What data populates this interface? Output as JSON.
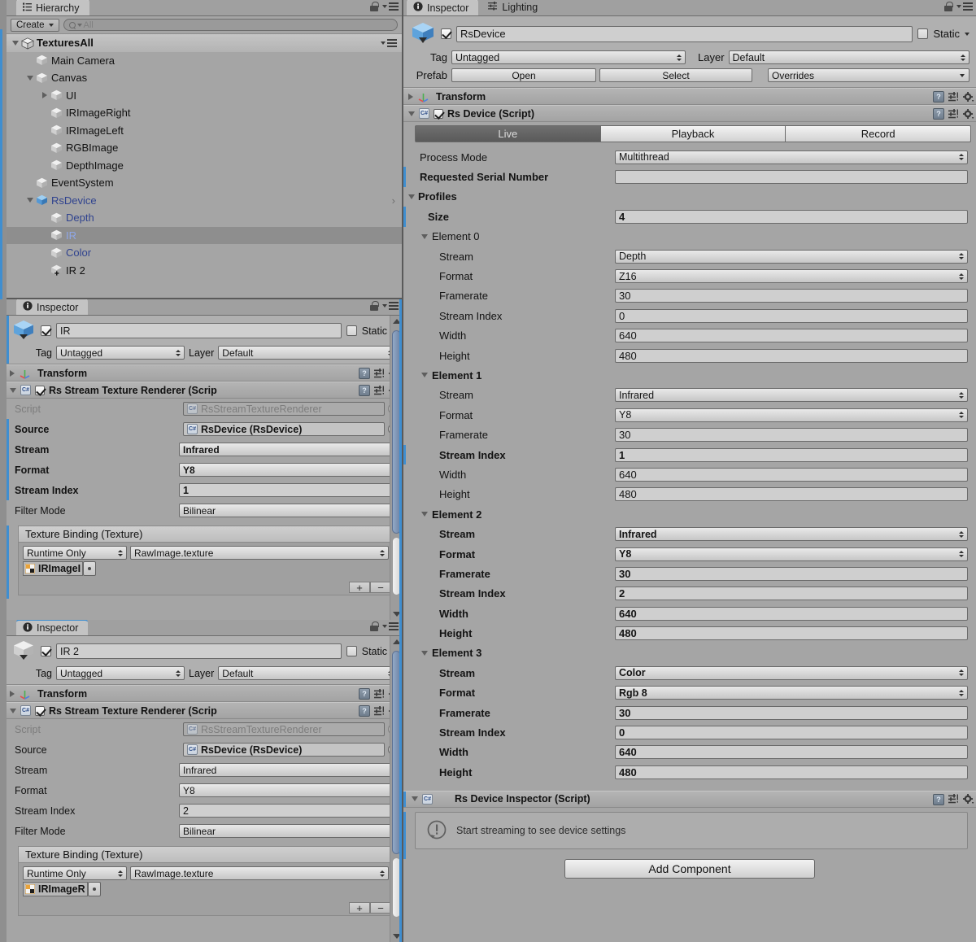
{
  "hierarchy": {
    "tab_label": "Hierarchy",
    "tab_icon": "hierarchy-icon",
    "create_label": "Create",
    "search_placeholder": "All",
    "search_value": "",
    "items": [
      {
        "label": "TexturesAll",
        "depth": 0,
        "fold": "down",
        "icon": "unity-scene-icon",
        "style": "scene"
      },
      {
        "label": "Main Camera",
        "depth": 1,
        "fold": "none",
        "icon": "gameobject-cube-icon",
        "style": "normal"
      },
      {
        "label": "Canvas",
        "depth": 1,
        "fold": "down",
        "icon": "gameobject-cube-icon",
        "style": "normal"
      },
      {
        "label": "UI",
        "depth": 2,
        "fold": "right",
        "icon": "gameobject-cube-icon",
        "style": "normal"
      },
      {
        "label": "IRImageRight",
        "depth": 2,
        "fold": "none",
        "icon": "gameobject-cube-icon",
        "style": "normal"
      },
      {
        "label": "IRImageLeft",
        "depth": 2,
        "fold": "none",
        "icon": "gameobject-cube-icon",
        "style": "normal"
      },
      {
        "label": "RGBImage",
        "depth": 2,
        "fold": "none",
        "icon": "gameobject-cube-icon",
        "style": "normal"
      },
      {
        "label": "DepthImage",
        "depth": 2,
        "fold": "none",
        "icon": "gameobject-cube-icon",
        "style": "normal"
      },
      {
        "label": "EventSystem",
        "depth": 1,
        "fold": "none",
        "icon": "gameobject-cube-icon",
        "style": "normal"
      },
      {
        "label": "RsDevice",
        "depth": 1,
        "fold": "down",
        "icon": "prefab-cube-icon",
        "style": "prefab",
        "chevron": true
      },
      {
        "label": "Depth",
        "depth": 2,
        "fold": "none",
        "icon": "gameobject-cube-icon",
        "style": "prefab"
      },
      {
        "label": "IR",
        "depth": 2,
        "fold": "none",
        "icon": "gameobject-cube-icon",
        "style": "selected"
      },
      {
        "label": "Color",
        "depth": 2,
        "fold": "none",
        "icon": "gameobject-cube-icon",
        "style": "prefab"
      },
      {
        "label": "IR 2",
        "depth": 2,
        "fold": "none",
        "icon": "gameobject-added-cube-icon",
        "style": "normal"
      }
    ]
  },
  "inspector_ir": {
    "tab_label": "Inspector",
    "name": "IR",
    "enabled": true,
    "static_label": "Static",
    "static_checked": false,
    "tag_label": "Tag",
    "tag_value": "Untagged",
    "layer_label": "Layer",
    "layer_value": "Default",
    "transform_label": "Transform",
    "component_label": "Rs Stream Texture Renderer (Scrip",
    "component_enabled": true,
    "fields": [
      {
        "label": "Script",
        "value": "RsStreamTextureRenderer",
        "type": "objectfield-readonly",
        "bold": false,
        "override": false
      },
      {
        "label": "Source",
        "value": "RsDevice (RsDevice)",
        "type": "objectfield",
        "bold": true,
        "override": true
      },
      {
        "label": "Stream",
        "value": "Infrared",
        "type": "dropdown",
        "bold": true,
        "override": true
      },
      {
        "label": "Format",
        "value": "Y8",
        "type": "dropdown",
        "bold": true,
        "override": true
      },
      {
        "label": "Stream Index",
        "value": "1",
        "type": "number",
        "bold": true,
        "override": true
      },
      {
        "label": "Filter Mode",
        "value": "Bilinear",
        "type": "dropdown",
        "bold": false,
        "override": false
      }
    ],
    "event_title": "Texture Binding (Texture)",
    "event_mode": "Runtime Only",
    "event_func": "RawImage.texture",
    "event_target": "IRImageI",
    "plus_label": "+",
    "minus_label": "−"
  },
  "inspector_ir2": {
    "tab_label": "Inspector",
    "name": "IR 2",
    "enabled": true,
    "static_label": "Static",
    "static_checked": false,
    "tag_label": "Tag",
    "tag_value": "Untagged",
    "layer_label": "Layer",
    "layer_value": "Default",
    "transform_label": "Transform",
    "component_label": "Rs Stream Texture Renderer (Scrip",
    "component_enabled": true,
    "fields": [
      {
        "label": "Script",
        "value": "RsStreamTextureRenderer",
        "type": "objectfield-readonly",
        "bold": false,
        "override": false
      },
      {
        "label": "Source",
        "value": "RsDevice (RsDevice)",
        "type": "objectfield",
        "bold": false,
        "override": false
      },
      {
        "label": "Stream",
        "value": "Infrared",
        "type": "dropdown",
        "bold": false,
        "override": false
      },
      {
        "label": "Format",
        "value": "Y8",
        "type": "dropdown",
        "bold": false,
        "override": false
      },
      {
        "label": "Stream Index",
        "value": "2",
        "type": "number",
        "bold": false,
        "override": false
      },
      {
        "label": "Filter Mode",
        "value": "Bilinear",
        "type": "dropdown",
        "bold": false,
        "override": false
      }
    ],
    "event_title": "Texture Binding (Texture)",
    "event_mode": "Runtime Only",
    "event_func": "RawImage.texture",
    "event_target": "IRImageR",
    "plus_label": "+",
    "minus_label": "−"
  },
  "inspector_device": {
    "tabs": [
      {
        "label": "Inspector",
        "icon": "info-icon",
        "active": true
      },
      {
        "label": "Lighting",
        "icon": "lighting-icon",
        "active": false
      }
    ],
    "name": "RsDevice",
    "enabled": true,
    "static_label": "Static",
    "static_checked": false,
    "tag_label": "Tag",
    "tag_value": "Untagged",
    "layer_label": "Layer",
    "layer_value": "Default",
    "prefab_label": "Prefab",
    "prefab_open": "Open",
    "prefab_select": "Select",
    "prefab_overrides": "Overrides",
    "transform_label": "Transform",
    "component_label": "Rs Device (Script)",
    "component_enabled": true,
    "mode_tabs": [
      {
        "label": "Live",
        "selected": true
      },
      {
        "label": "Playback",
        "selected": false
      },
      {
        "label": "Record",
        "selected": false
      }
    ],
    "process_mode_label": "Process Mode",
    "process_mode_value": "Multithread",
    "serial_label": "Requested Serial Number",
    "serial_value": "",
    "profiles_label": "Profiles",
    "size_label": "Size",
    "size_value": "4",
    "elements": [
      {
        "title": "Element 0",
        "title_bold": false,
        "override": false,
        "rows": [
          {
            "label": "Stream",
            "value": "Depth",
            "type": "dropdown",
            "bold": false,
            "override": false
          },
          {
            "label": "Format",
            "value": "Z16",
            "type": "dropdown",
            "bold": false,
            "override": false
          },
          {
            "label": "Framerate",
            "value": "30",
            "type": "number",
            "bold": false,
            "override": false
          },
          {
            "label": "Stream Index",
            "value": "0",
            "type": "number",
            "bold": false,
            "override": false
          },
          {
            "label": "Width",
            "value": "640",
            "type": "number",
            "bold": false,
            "override": false
          },
          {
            "label": "Height",
            "value": "480",
            "type": "number",
            "bold": false,
            "override": false
          }
        ]
      },
      {
        "title": "Element 1",
        "title_bold": true,
        "override": false,
        "rows": [
          {
            "label": "Stream",
            "value": "Infrared",
            "type": "dropdown",
            "bold": false,
            "override": false
          },
          {
            "label": "Format",
            "value": "Y8",
            "type": "dropdown",
            "bold": false,
            "override": false
          },
          {
            "label": "Framerate",
            "value": "30",
            "type": "number",
            "bold": false,
            "override": false
          },
          {
            "label": "Stream Index",
            "value": "1",
            "type": "number",
            "bold": true,
            "override": true
          },
          {
            "label": "Width",
            "value": "640",
            "type": "number",
            "bold": false,
            "override": false
          },
          {
            "label": "Height",
            "value": "480",
            "type": "number",
            "bold": false,
            "override": false
          }
        ]
      },
      {
        "title": "Element 2",
        "title_bold": true,
        "override": false,
        "rows": [
          {
            "label": "Stream",
            "value": "Infrared",
            "type": "dropdown",
            "bold": true,
            "override": false
          },
          {
            "label": "Format",
            "value": "Y8",
            "type": "dropdown",
            "bold": true,
            "override": false
          },
          {
            "label": "Framerate",
            "value": "30",
            "type": "number",
            "bold": true,
            "override": false
          },
          {
            "label": "Stream Index",
            "value": "2",
            "type": "number",
            "bold": true,
            "override": false
          },
          {
            "label": "Width",
            "value": "640",
            "type": "number",
            "bold": true,
            "override": false
          },
          {
            "label": "Height",
            "value": "480",
            "type": "number",
            "bold": true,
            "override": false
          }
        ]
      },
      {
        "title": "Element 3",
        "title_bold": true,
        "override": false,
        "rows": [
          {
            "label": "Stream",
            "value": "Color",
            "type": "dropdown",
            "bold": true,
            "override": false
          },
          {
            "label": "Format",
            "value": "Rgb 8",
            "type": "dropdown",
            "bold": true,
            "override": false
          },
          {
            "label": "Framerate",
            "value": "30",
            "type": "number",
            "bold": true,
            "override": false
          },
          {
            "label": "Stream Index",
            "value": "0",
            "type": "number",
            "bold": true,
            "override": false
          },
          {
            "label": "Width",
            "value": "640",
            "type": "number",
            "bold": true,
            "override": false
          },
          {
            "label": "Height",
            "value": "480",
            "type": "number",
            "bold": true,
            "override": false
          }
        ]
      }
    ],
    "second_component_label": "Rs Device Inspector (Script)",
    "help_text": "Start streaming to see device settings",
    "add_component_label": "Add Component"
  },
  "colors": {
    "panel_bg": "#a5a5a5",
    "accent_blue": "#3f8ed0",
    "prefab_blue": "#30438f",
    "selection_gray": "#8e8e8e",
    "scrollbar_thumb": "#7b90b0"
  }
}
